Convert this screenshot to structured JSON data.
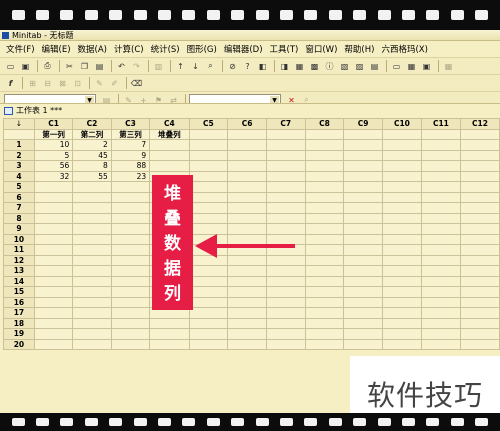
{
  "app": {
    "title": "Minitab - 无标题"
  },
  "menu": [
    "文件(F)",
    "编辑(E)",
    "数据(A)",
    "计算(C)",
    "统计(S)",
    "图形(G)",
    "编辑器(D)",
    "工具(T)",
    "窗口(W)",
    "帮助(H)",
    "六西格玛(X)"
  ],
  "worksheet": {
    "title": "工作表 1 ***",
    "corner_mark": "↓",
    "columns": [
      "C1",
      "C2",
      "C3",
      "C4",
      "C5",
      "C6",
      "C7",
      "C8",
      "C9",
      "C10",
      "C11",
      "C12"
    ],
    "column_names": [
      "第一列",
      "第二列",
      "第三列",
      "堆叠列",
      "",
      "",
      "",
      "",
      "",
      "",
      "",
      ""
    ],
    "row_numbers": [
      "1",
      "2",
      "3",
      "4",
      "5",
      "6",
      "7",
      "8",
      "9",
      "10",
      "11",
      "12",
      "13",
      "14",
      "15",
      "16",
      "17",
      "18",
      "19",
      "20"
    ],
    "rows": [
      [
        "10",
        "2",
        "7"
      ],
      [
        "5",
        "45",
        "9"
      ],
      [
        "56",
        "8",
        "88"
      ],
      [
        "32",
        "55",
        "23"
      ]
    ]
  },
  "annotation": {
    "chars": [
      "堆",
      "叠",
      "数",
      "据",
      "列"
    ],
    "color": "#e61d45"
  },
  "watermark": {
    "text": "软件技巧"
  }
}
